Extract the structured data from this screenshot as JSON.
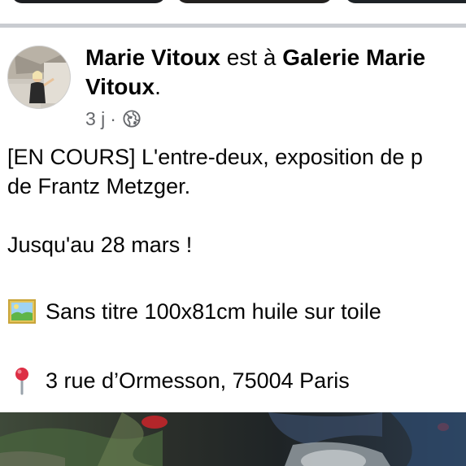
{
  "post": {
    "author": "Marie Vitoux",
    "connector": " est à ",
    "place": "Galerie Marie Vitoux",
    "place_suffix": ".",
    "time": "3 j",
    "dot": "·",
    "privacy_icon": "globe-icon"
  },
  "body": {
    "line1": "[EN COURS] L'entre-deux, exposition de p",
    "line2": "de Frantz Metzger.",
    "line3": "Jusqu'au 28 mars !",
    "line4_icon": "framed-picture-icon",
    "line4": "Sans titre 100x81cm huile sur toile",
    "line5_icon": "round-pushpin-icon",
    "line5": "3 rue d’Ormesson, 75004 Paris"
  },
  "colors": {
    "text": "#050505",
    "secondary_text": "#65676b",
    "separator": "#c9ccd1"
  }
}
